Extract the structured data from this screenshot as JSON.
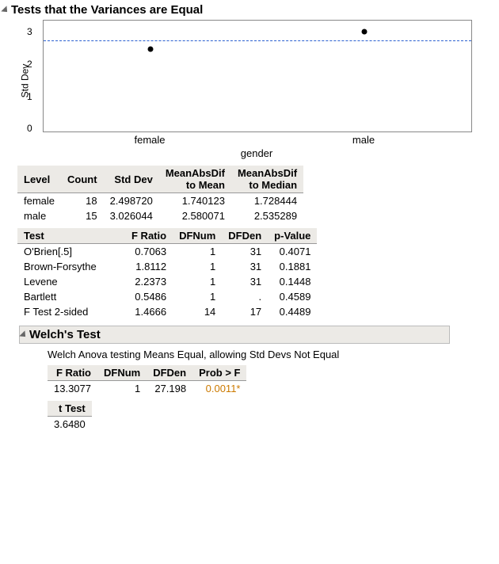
{
  "chart_data": {
    "type": "scatter",
    "title": "Tests that the Variances are Equal",
    "xlabel": "gender",
    "ylabel": "Std Dev",
    "ylim": [
      0,
      3.3
    ],
    "yticks": [
      0,
      1,
      2,
      3
    ],
    "categories": [
      "female",
      "male"
    ],
    "values": [
      2.4987,
      3.026
    ],
    "reference_line": 2.75
  },
  "section_title": "Tests that the Variances are Equal",
  "summary_table": {
    "headers": [
      "Level",
      "Count",
      "Std Dev",
      "MeanAbsDif to Mean",
      "MeanAbsDif to Median"
    ],
    "rows": [
      {
        "level": "female",
        "count": "18",
        "stddev": "2.498720",
        "mad_mean": "1.740123",
        "mad_median": "1.728444"
      },
      {
        "level": "male",
        "count": "15",
        "stddev": "3.026044",
        "mad_mean": "2.580071",
        "mad_median": "2.535289"
      }
    ]
  },
  "tests_table": {
    "headers": [
      "Test",
      "F Ratio",
      "DFNum",
      "DFDen",
      "p-Value"
    ],
    "rows": [
      {
        "test": "O'Brien[.5]",
        "f": "0.7063",
        "dfn": "1",
        "dfd": "31",
        "p": "0.4071"
      },
      {
        "test": "Brown-Forsythe",
        "f": "1.8112",
        "dfn": "1",
        "dfd": "31",
        "p": "0.1881"
      },
      {
        "test": "Levene",
        "f": "2.2373",
        "dfn": "1",
        "dfd": "31",
        "p": "0.1448"
      },
      {
        "test": "Bartlett",
        "f": "0.5486",
        "dfn": "1",
        "dfd": ".",
        "p": "0.4589"
      },
      {
        "test": "F Test 2-sided",
        "f": "1.4666",
        "dfn": "14",
        "dfd": "17",
        "p": "0.4489"
      }
    ]
  },
  "welch": {
    "title": "Welch's Test",
    "caption": "Welch Anova testing Means Equal, allowing Std Devs Not Equal",
    "headers": [
      "F Ratio",
      "DFNum",
      "DFDen",
      "Prob > F"
    ],
    "row": {
      "f": "13.3077",
      "dfn": "1",
      "dfd": "27.198",
      "p": "0.0011*"
    },
    "ttest_label": "t Test",
    "ttest_value": "3.6480"
  }
}
